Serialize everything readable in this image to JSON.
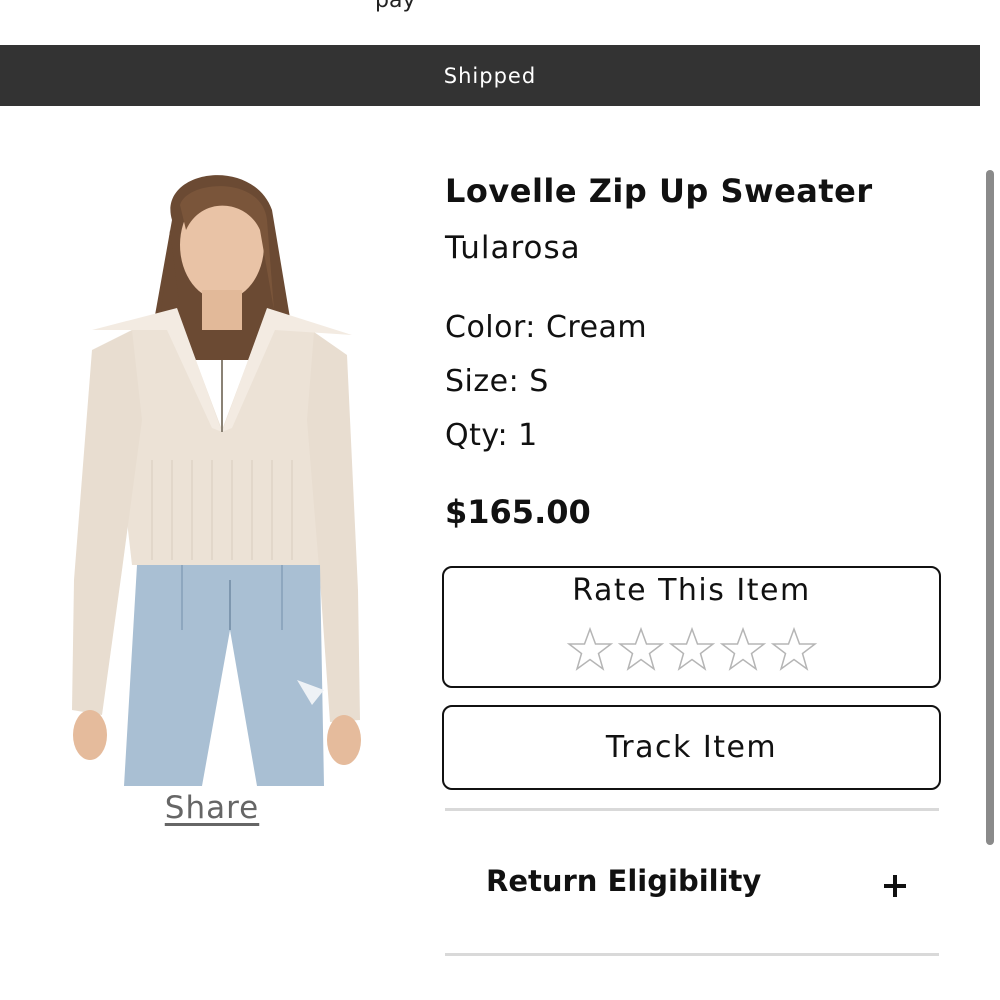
{
  "header": {
    "cut_text": "pay",
    "status": "Shipped"
  },
  "product": {
    "title": "Lovelle Zip Up Sweater",
    "brand": "Tularosa",
    "color": "Color: Cream",
    "size": "Size: S",
    "qty": "Qty: 1",
    "price": "$165.00",
    "share_label": "Share"
  },
  "rating": {
    "label": "Rate This Item",
    "max_stars": 5,
    "value": 0,
    "star_icon": "star-outline-icon"
  },
  "actions": {
    "track_label": "Track Item"
  },
  "accordion": {
    "label": "Return Eligibility",
    "toggle_icon": "plus-icon"
  },
  "colors": {
    "status_bar": "#333333",
    "text": "#111111",
    "star_outline": "#b5b5b5",
    "divider": "#d9d9d9",
    "share_link": "#666666"
  }
}
